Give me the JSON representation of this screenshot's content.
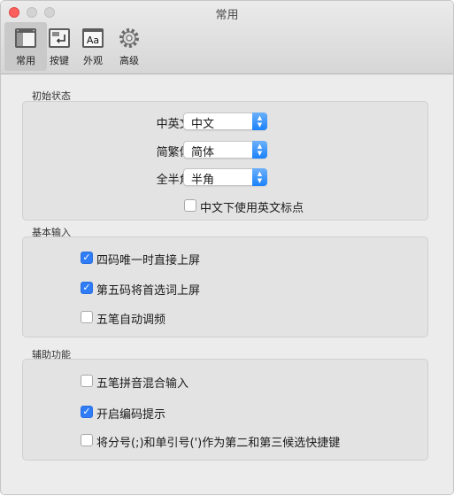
{
  "window": {
    "title": "常用"
  },
  "toolbar": {
    "items": [
      {
        "label": "常用",
        "icon": "general-icon",
        "selected": true
      },
      {
        "label": "按键",
        "icon": "keys-icon",
        "selected": false
      },
      {
        "label": "外观",
        "icon": "appearance-icon",
        "selected": false
      },
      {
        "label": "高级",
        "icon": "gear-icon",
        "selected": false
      }
    ]
  },
  "sections": {
    "initial": {
      "title": "初始状态",
      "rows": [
        {
          "label": "中英文:",
          "value": "中文"
        },
        {
          "label": "简繁体:",
          "value": "简体"
        },
        {
          "label": "全半角:",
          "value": "半角"
        }
      ],
      "checkbox": {
        "label": "中文下使用英文标点",
        "checked": false
      }
    },
    "basic": {
      "title": "基本输入",
      "options": [
        {
          "label": "四码唯一时直接上屏",
          "checked": true
        },
        {
          "label": "第五码将首选词上屏",
          "checked": true
        },
        {
          "label": "五笔自动调频",
          "checked": false
        }
      ]
    },
    "aux": {
      "title": "辅助功能",
      "options": [
        {
          "label": "五笔拼音混合输入",
          "checked": false
        },
        {
          "label": "开启编码提示",
          "checked": true
        },
        {
          "label": "将分号(;)和单引号(')作为第二和第三候选快捷键",
          "checked": false
        }
      ]
    }
  },
  "colors": {
    "accent": "#2f7cf6",
    "close": "#fc605c"
  }
}
